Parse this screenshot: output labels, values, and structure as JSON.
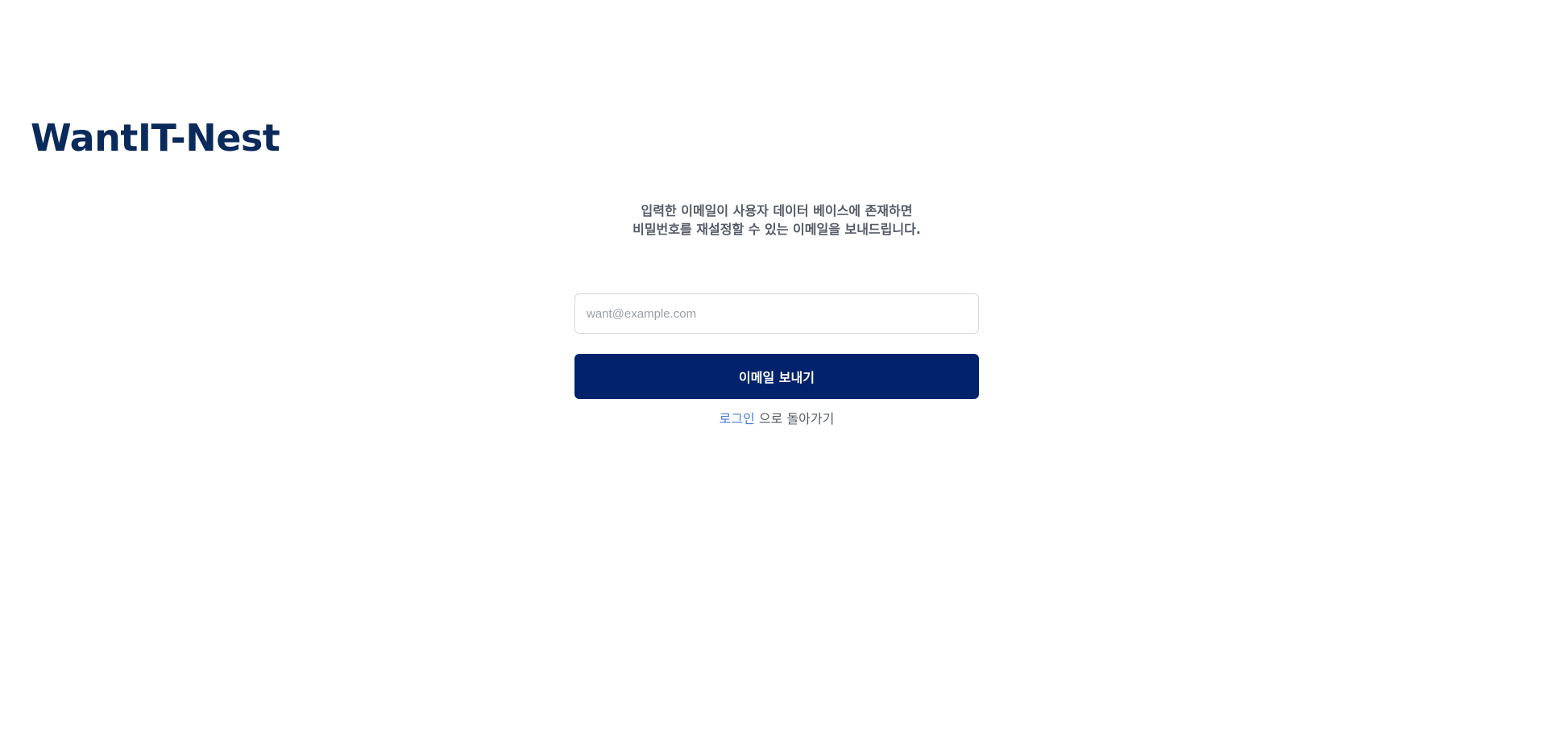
{
  "header": {
    "logo_text": "WantIT-Nest"
  },
  "reset_form": {
    "description_line1": "입력한 이메일이 사용자 데이터 베이스에 존재하면",
    "description_line2": "비밀번호를 재설정할 수 있는 이메일을 보내드립니다.",
    "email_placeholder": "want@example.com",
    "email_value": "",
    "submit_label": "이메일 보내기",
    "back_link_label": "로그인",
    "back_suffix": " 으로 돌아가기"
  },
  "colors": {
    "brand_navy": "#0b2a5c",
    "button_bg": "#02236b",
    "link_blue": "#4a7fd6",
    "text_gray": "#555b66"
  }
}
